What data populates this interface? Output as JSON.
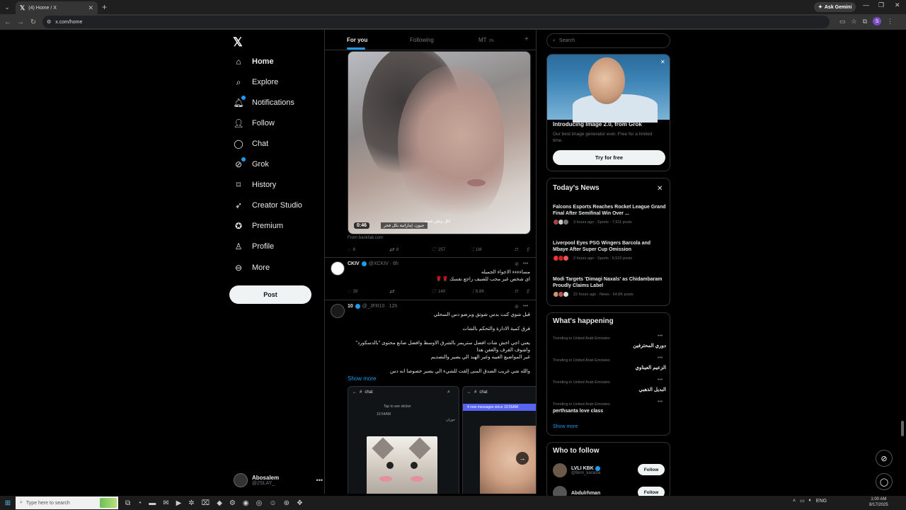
{
  "browser": {
    "tab_title": "(4) Home / X",
    "url": "x.com/home",
    "ask_gemini": "Ask Gemini",
    "profile_initial": "S"
  },
  "nav": {
    "items": [
      {
        "label": "Home",
        "icon": "home-icon"
      },
      {
        "label": "Explore",
        "icon": "search-icon"
      },
      {
        "label": "Notifications",
        "icon": "bell-icon"
      },
      {
        "label": "Follow",
        "icon": "person-add-icon"
      },
      {
        "label": "Chat",
        "icon": "chat-bubble-icon"
      },
      {
        "label": "Grok",
        "icon": "grok-icon"
      },
      {
        "label": "History",
        "icon": "bookmark-icon"
      },
      {
        "label": "Creator Studio",
        "icon": "rocket-icon"
      },
      {
        "label": "Premium",
        "icon": "verified-badge-icon"
      },
      {
        "label": "Profile",
        "icon": "person-icon"
      },
      {
        "label": "More",
        "icon": "more-circle-icon"
      }
    ],
    "post_button": "Post",
    "account": {
      "name": "Abosalem",
      "handle": "@2SLAY_"
    }
  },
  "timeline": {
    "tabs": [
      "For you",
      "Following",
      "MT"
    ],
    "mt_count": "1%",
    "video": {
      "time": "0:46",
      "caption_main": "جيون، إماراتية بكل فخر",
      "caption_small": "لكل وطن قصة",
      "source": "From bankfab.com"
    },
    "video_actions": {
      "replies": "6",
      "reposts": "8",
      "likes": "257",
      "views": "1M"
    },
    "post1": {
      "name": "CKIV",
      "handle": "@XCKIV · 6h",
      "lines": [
        "مساءءءء الاجواء الجميله",
        "اي شخص غير محب للصيف راجع نفسك 🌹🌹"
      ],
      "replies": "39",
      "reposts": "",
      "likes": "140",
      "views": "6.8K"
    },
    "post2": {
      "name": "10",
      "handle": "@_JFR10 · 12h",
      "lines": [
        "قبل شوي كنت بدس شوتق وبرضو دس السحلي",
        "فرق كمية الادارة والتحكم بالشات",
        "يعني اجي اخش شات افضل ستريمر بالشرق الاوسط وافضل صانع محتوى \"بالدسكورد\"",
        "واشوف القرف والعفن هذا",
        "غير المواضيع الغبيه وغير الهبد الي يصير والتصديم",
        "والله شي غريب الصدق المنى إلقت للشيء الي يصير خصوصا انه دس"
      ],
      "show_more": "Show more",
      "shot1_header": "chat",
      "shot1_tap": "Tap to see sticker",
      "shot1_time": "10:54AM",
      "shot1_name": "حوران",
      "shot2_header": "chat",
      "shot2_banner": "4 new messages since 10:55AM"
    }
  },
  "sidebar": {
    "search_placeholder": "Search",
    "grok": {
      "title": "Introducing Image 2.0, from Grok",
      "desc": "Our best image generator ever. Free for a limited time.",
      "button": "Try for free"
    },
    "news": {
      "title": "Today's News",
      "items": [
        {
          "headline": "Falcons Esports Reaches Rocket League Grand Final After Semifinal Win Over ...",
          "meta": "3 hours ago · Sports · 7,911 posts"
        },
        {
          "headline": "Liverpool Eyes PSG Wingers Barcola and Mbaye After Super Cup Omission",
          "meta": "2 hours ago · Sports · 6,523 posts"
        },
        {
          "headline": "Modi Targets 'Dimagi Naxals' as Chidambaram Proudly Claims Label",
          "meta": "22 hours ago · News · 64.8K posts"
        }
      ]
    },
    "happening": {
      "title": "What's happening",
      "trends": [
        {
          "context": "Trending in United Arab Emirates",
          "name": "دوري المحترفين"
        },
        {
          "context": "Trending in United Arab Emirates",
          "name": "الزعيم العيناوي"
        },
        {
          "context": "Trending in United Arab Emirates",
          "name": "البديل الذهبي"
        },
        {
          "context": "Trending in United Arab Emirates",
          "name": "perthsanta love class"
        }
      ],
      "show_more": "Show more"
    },
    "who_to_follow": {
      "title": "Who to follow",
      "users": [
        {
          "name": "LVLI KBK",
          "handle": "@Binn_karama",
          "button": "Follow"
        },
        {
          "name": "Abdulrhman",
          "handle": "",
          "button": "Follow"
        }
      ]
    }
  },
  "taskbar": {
    "search_placeholder": "Type here to search",
    "lang": "ENG",
    "time": "1:00 AM",
    "date": "8/17/2025"
  },
  "colors": {
    "accent": "#1d9bf0",
    "background": "#000000",
    "border": "#2f3336",
    "muted": "#71767b"
  }
}
